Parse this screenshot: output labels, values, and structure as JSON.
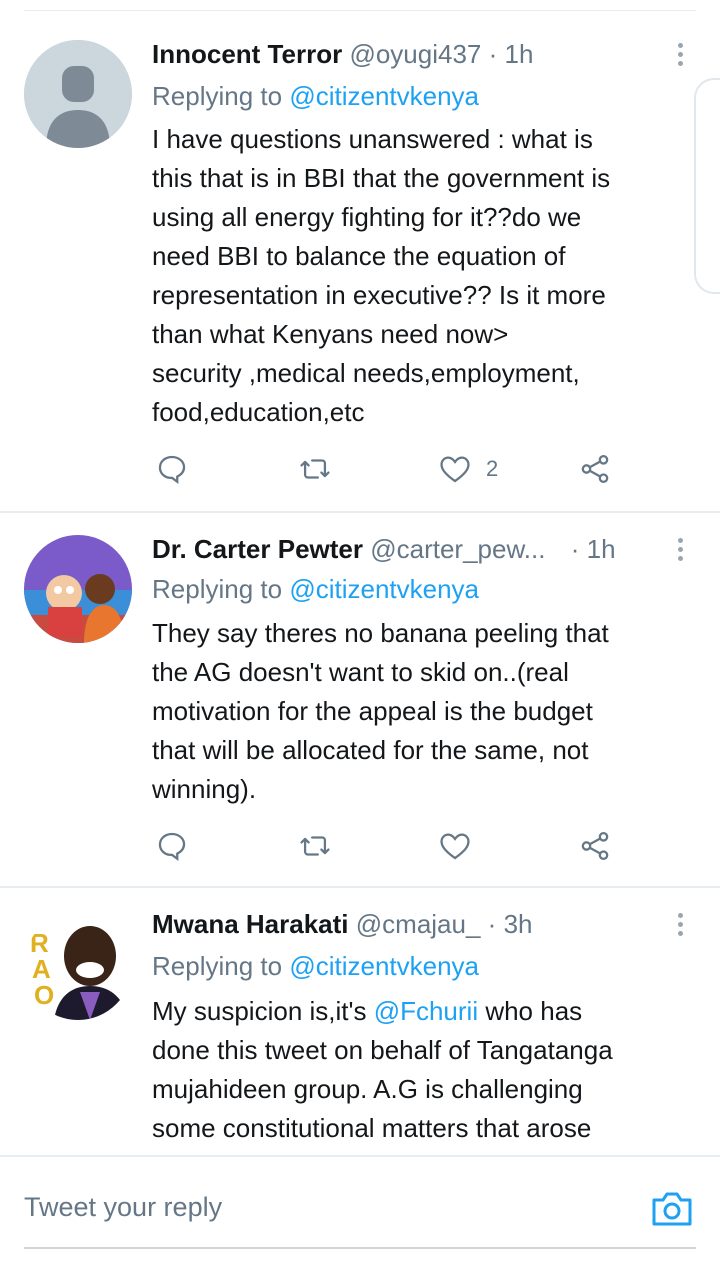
{
  "colors": {
    "link": "#1da1f2",
    "muted": "#657786",
    "text": "#14171a",
    "divider": "#e6ecf0"
  },
  "tweets": [
    {
      "name": "Innocent Terror",
      "handle": "@oyugi437",
      "sep": "·",
      "time": "1h",
      "replying_prefix": "Replying to",
      "replying_to": "@citizentvkenya",
      "text_lines": [
        "I have questions unanswered : what is",
        "this that is in BBI that the government is",
        "using all energy fighting for it??do we",
        "need BBI to balance the equation of",
        "representation in executive?? Is it more",
        "than what Kenyans need now>",
        "security ,medical needs,employment,",
        "food,education,etc"
      ],
      "like_count": "2",
      "avatar_icon": "default-avatar-icon"
    },
    {
      "name": "Dr. Carter Pewter",
      "handle": "@carter_pew...",
      "sep": "·",
      "time": "1h",
      "replying_prefix": "Replying to",
      "replying_to": "@citizentvkenya",
      "text_lines": [
        "They say theres no banana peeling that",
        "the AG doesn't want to skid on..(real",
        "motivation for the appeal is the budget",
        "that will be allocated for the same, not",
        "winning)."
      ],
      "avatar_icon": "cartoon-avatar-icon"
    },
    {
      "name": "Mwana Harakati",
      "handle": "@cmajau_",
      "sep": "·",
      "time": "3h",
      "replying_prefix": "Replying to",
      "replying_to": "@citizentvkenya",
      "text_line1_prefix": "My suspicion is,it's ",
      "text_line1_mention": "@Fchurii",
      "text_line1_suffix": " who has",
      "text_lines": [
        "done this tweet on behalf of Tangatanga",
        "mujahideen group. A.G is challenging",
        "some constitutional matters that arose"
      ],
      "avatar_icon": "photo-avatar-icon"
    }
  ],
  "composer": {
    "placeholder": "Tweet your reply",
    "camera_icon": "camera-icon"
  }
}
